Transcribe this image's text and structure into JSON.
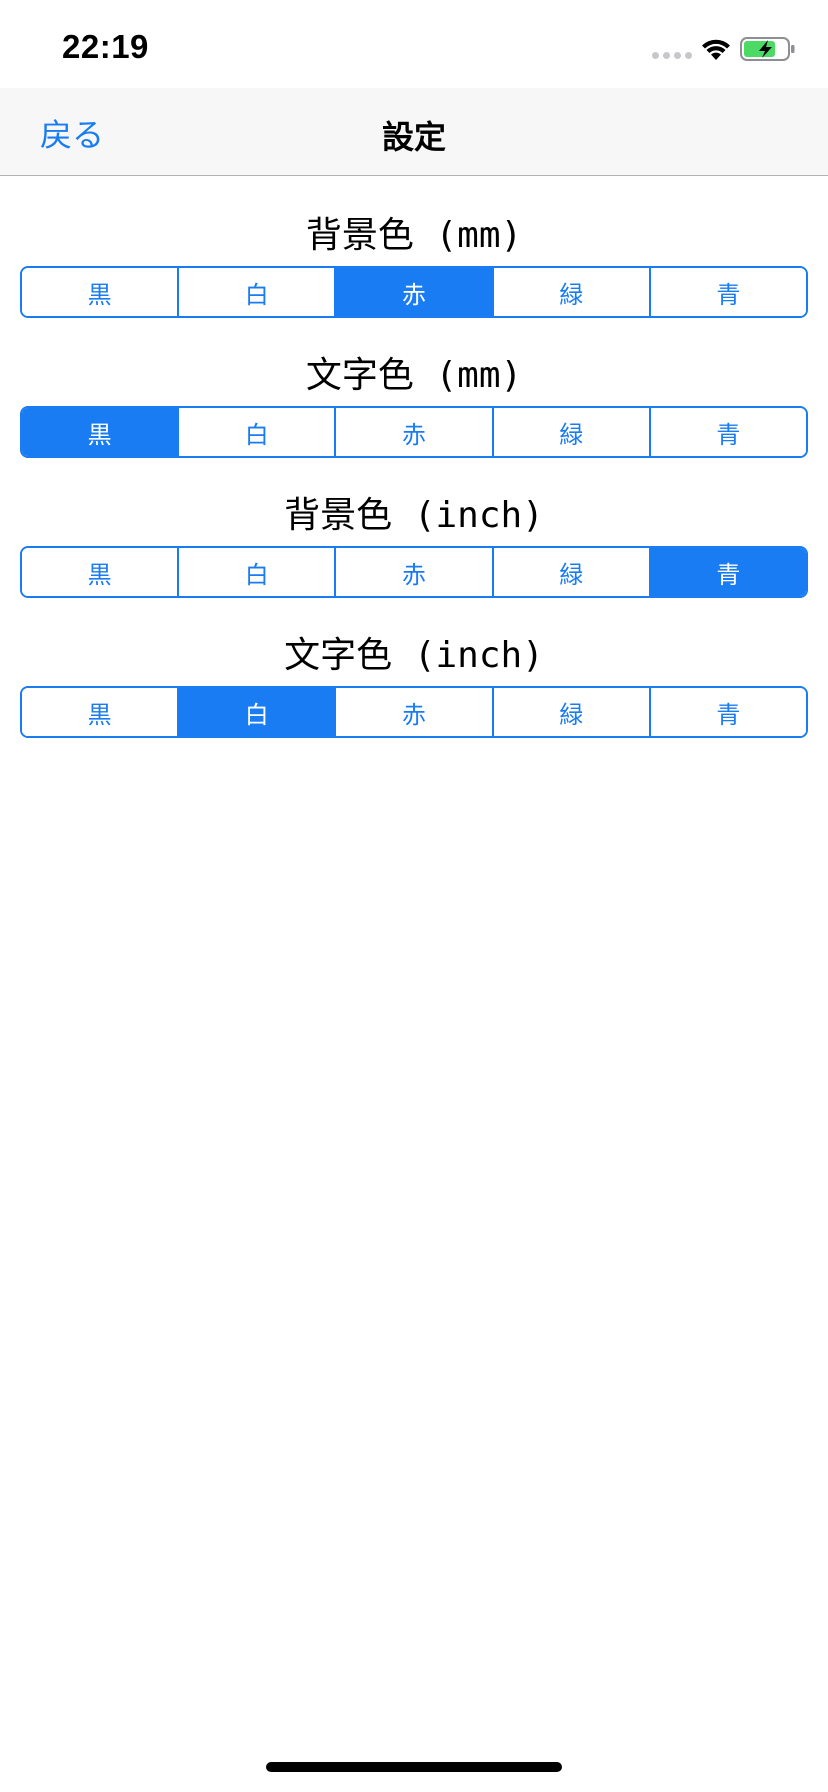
{
  "status_bar": {
    "time": "22:19",
    "icons": [
      "signal-dots-icon",
      "wifi-icon",
      "battery-charging-icon"
    ],
    "battery_color": "#4cd964"
  },
  "nav": {
    "back_label": "戻る",
    "title": "設定"
  },
  "colors": {
    "accent": "#1a7cf2"
  },
  "sections": [
    {
      "title": "背景色 (mm)",
      "options": [
        "黒",
        "白",
        "赤",
        "緑",
        "青"
      ],
      "selected": "赤"
    },
    {
      "title": "文字色 (mm)",
      "options": [
        "黒",
        "白",
        "赤",
        "緑",
        "青"
      ],
      "selected": "黒"
    },
    {
      "title": "背景色 (inch)",
      "options": [
        "黒",
        "白",
        "赤",
        "緑",
        "青"
      ],
      "selected": "青"
    },
    {
      "title": "文字色 (inch)",
      "options": [
        "黒",
        "白",
        "赤",
        "緑",
        "青"
      ],
      "selected": "白"
    }
  ]
}
